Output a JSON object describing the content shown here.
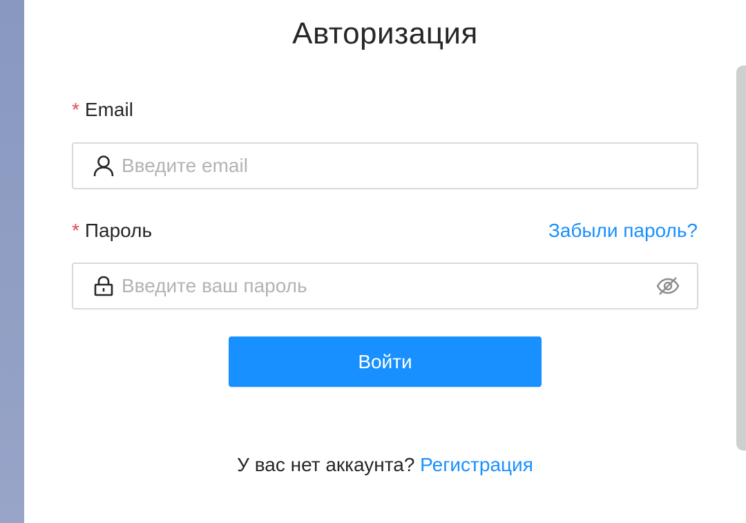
{
  "page": {
    "title": "Авторизация"
  },
  "form": {
    "email": {
      "required_mark": "*",
      "label": "Email",
      "placeholder": "Введите email",
      "value": "",
      "icon": "user-icon"
    },
    "password": {
      "required_mark": "*",
      "label": "Пароль",
      "placeholder": "Введите ваш пароль",
      "value": "",
      "icon": "lock-icon",
      "visibility_icon": "eye-off-icon"
    },
    "forgot_label": "Забыли пароль?",
    "submit_label": "Войти"
  },
  "footer": {
    "prompt": "У вас нет аккаунта?",
    "register_label": "Регистрация"
  },
  "colors": {
    "primary": "#1890ff",
    "required": "#e5484d",
    "text": "#262626",
    "placeholder": "#b3b3b3",
    "border": "#d9d9d9",
    "side_strip": "#8898bf"
  }
}
